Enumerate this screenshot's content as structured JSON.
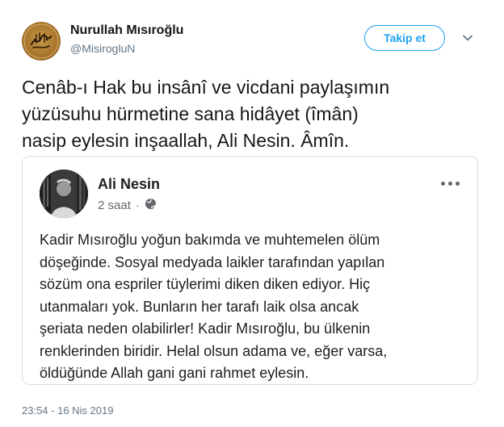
{
  "tweet": {
    "display_name": "Nurullah Mısıroğlu",
    "handle": "@MisirogluN",
    "follow_label": "Takip et",
    "text_lines": [
      "Cenâb-ı Hak bu insânî ve vicdani paylaşımın",
      "yüzüsuhu hürmetine sana hidâyet (îmân)",
      "nasip eylesin inşaallah, Ali Nesin. Âmîn."
    ],
    "timestamp": "23:54 - 16 Nis 2019"
  },
  "embedded_post": {
    "author": "Ali Nesin",
    "time": "2 saat",
    "separator": "·",
    "privacy_icon": "globe-icon",
    "body_lines": [
      "Kadir Mısıroğlu yoğun bakımda ve muhtemelen ölüm",
      "döşeğinde. Sosyal medyada laikler tarafından yapılan",
      "sözüm ona espriler tüylerimi diken diken ediyor. Hiç",
      "utanmaları yok. Bunların her tarafı laik olsa ancak",
      "şeriata neden olabilirler! Kadir Mısıroğlu, bu ülkenin",
      "renklerinden biridir. Helal olsun adama ve, eğer varsa,",
      "öldüğünde Allah gani gani rahmet eylesin."
    ]
  },
  "colors": {
    "accent": "#1da1f2",
    "muted": "#657786",
    "text": "#14171a",
    "card_border": "#d8dee3"
  }
}
